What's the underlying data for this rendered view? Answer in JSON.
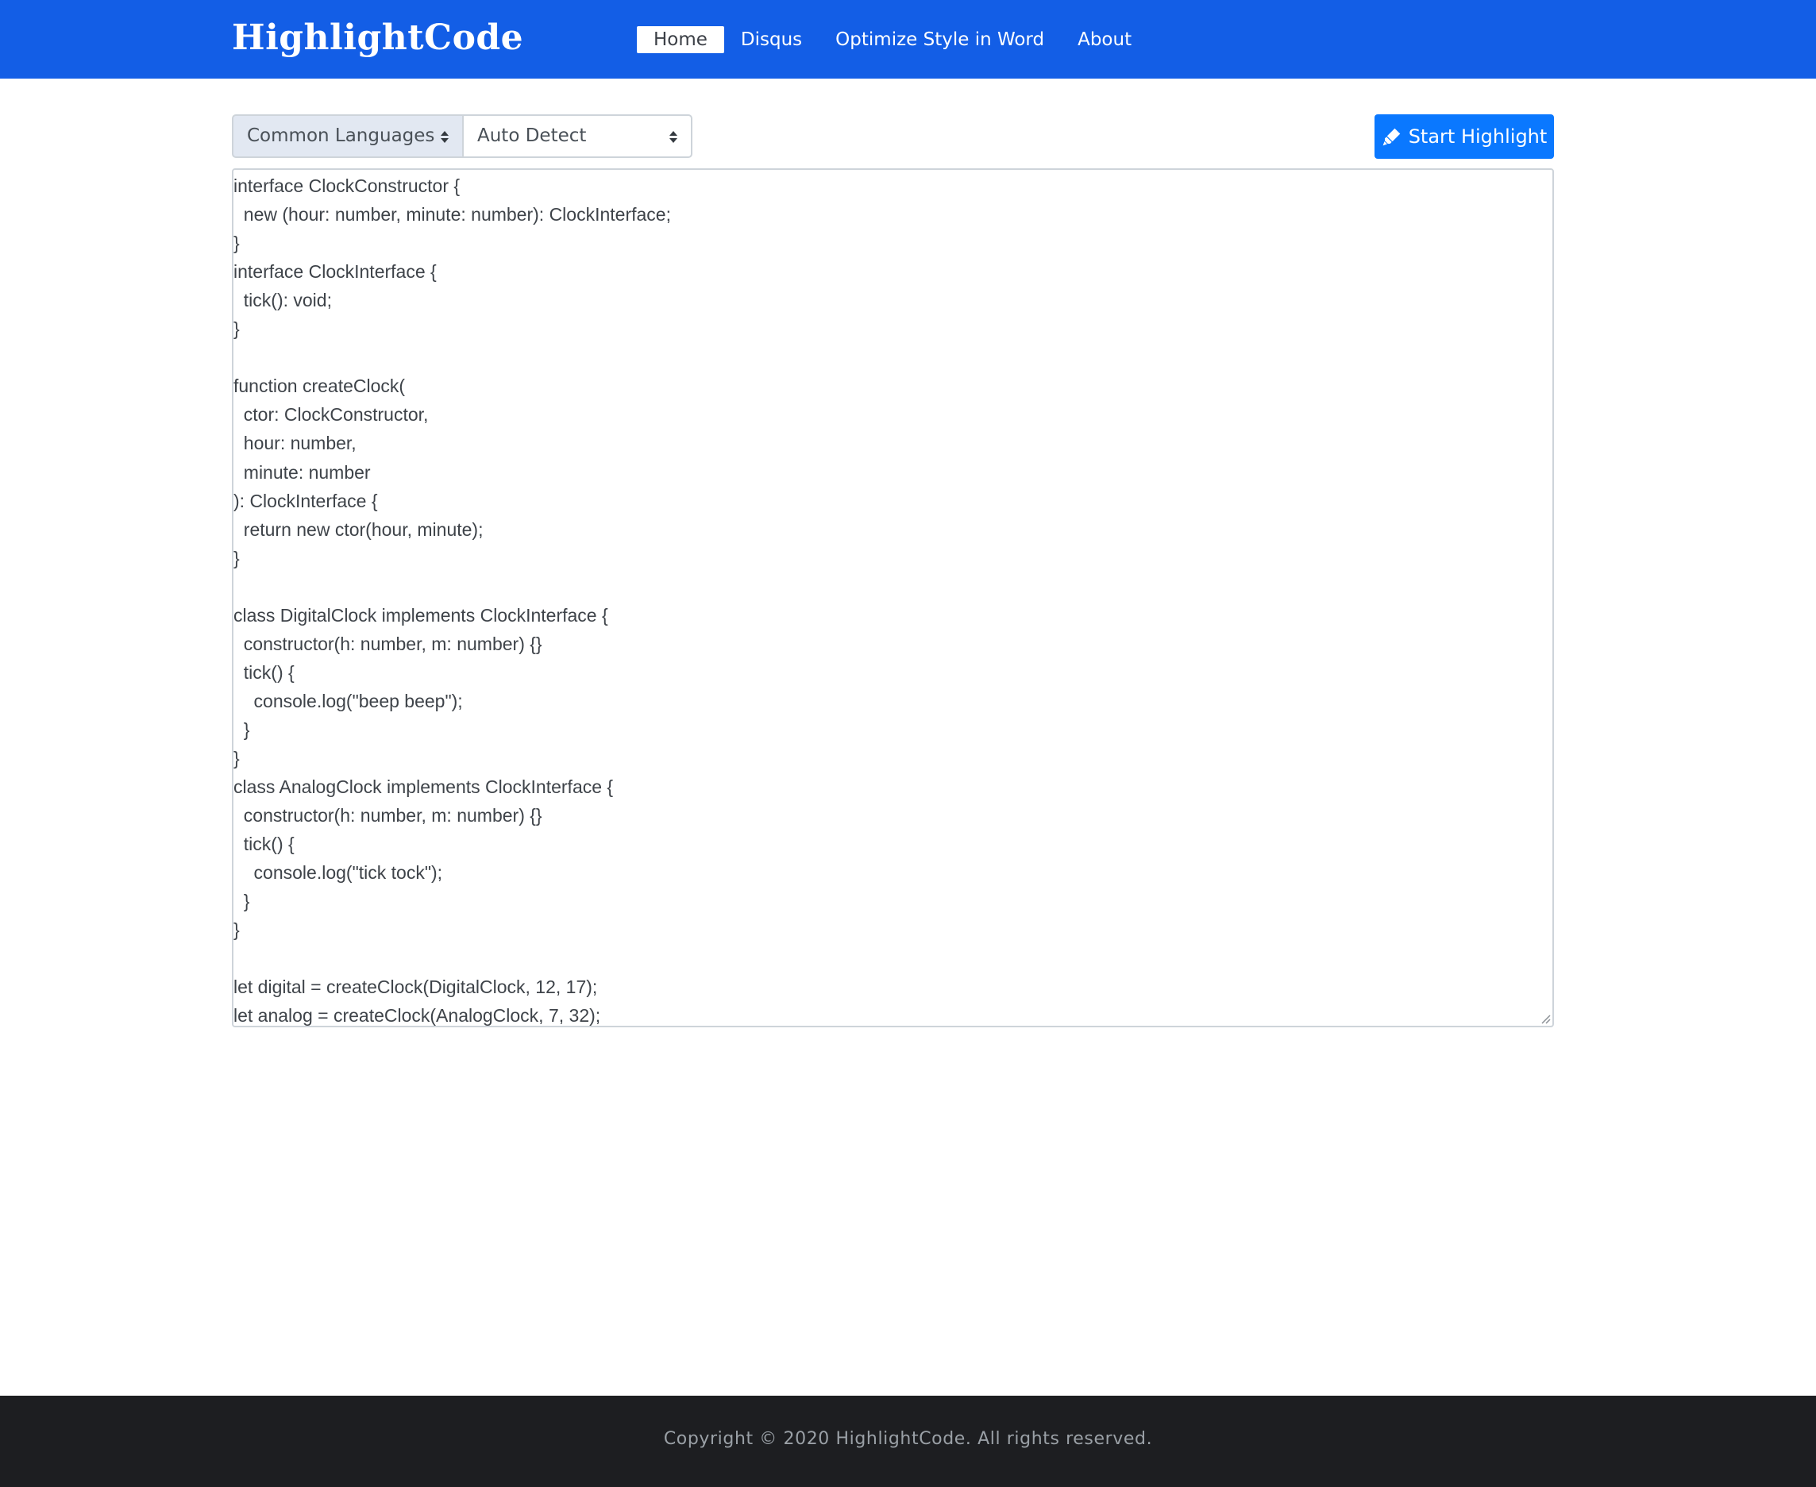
{
  "brand": "HighlightCode",
  "nav": {
    "home": "Home",
    "disqus": "Disqus",
    "optimize": "Optimize Style in Word",
    "about": "About"
  },
  "toolbar": {
    "language_group": "Common Languages",
    "language": "Auto Detect",
    "start_button": "Start Highlight",
    "start_icon": "highlighter-icon"
  },
  "editor": {
    "lines": [
      "interface ClockConstructor {",
      "  new (hour: number, minute: number): ClockInterface;",
      "}",
      "interface ClockInterface {",
      "  tick(): void;",
      "}",
      "",
      "function createClock(",
      "  ctor: ClockConstructor,",
      "  hour: number,",
      "  minute: number",
      "): ClockInterface {",
      "  return new ctor(hour, minute);",
      "}",
      "",
      "class DigitalClock implements ClockInterface {",
      "  constructor(h: number, m: number) {}",
      "  tick() {",
      "    console.log(\"beep beep\");",
      "  }",
      "}",
      "class AnalogClock implements ClockInterface {",
      "  constructor(h: number, m: number) {}",
      "  tick() {",
      "    console.log(\"tick tock\");",
      "  }",
      "}",
      "",
      "let digital = createClock(DigitalClock, 12, 17);",
      "let analog = createClock(AnalogClock, 7, 32);"
    ]
  },
  "footer": {
    "copyright": "Copyright © 2020 HighlightCode. All rights reserved."
  },
  "colors": {
    "navbar": "#135ee6",
    "button": "#0a78ff",
    "footer": "#1d1e21"
  }
}
